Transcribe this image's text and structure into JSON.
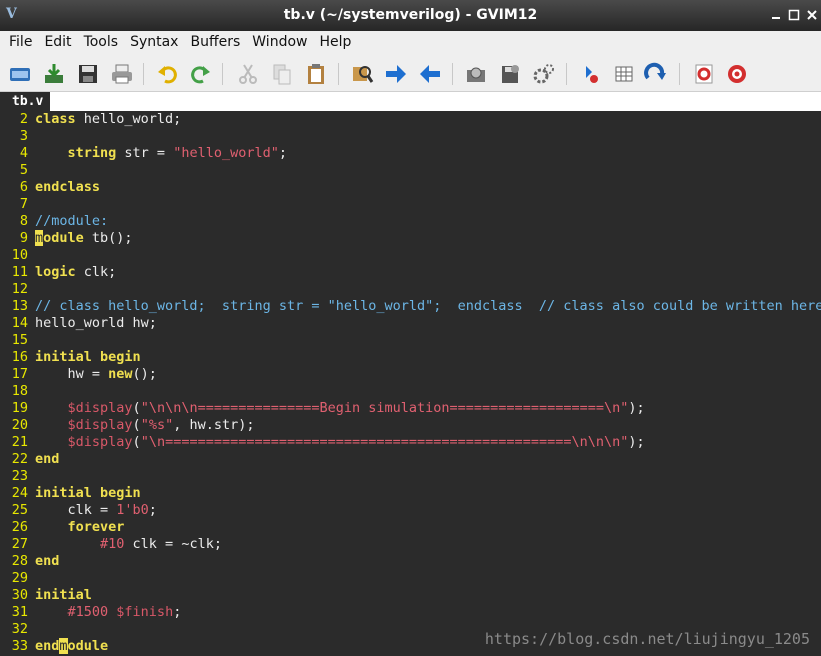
{
  "window": {
    "title": "tb.v (~/systemverilog) - GVIM12"
  },
  "menubar": {
    "items": [
      "File",
      "Edit",
      "Tools",
      "Syntax",
      "Buffers",
      "Window",
      "Help"
    ]
  },
  "toolbar": {
    "buttons": [
      "open-icon",
      "save-download-icon",
      "save-icon",
      "print-icon",
      "undo-icon",
      "redo-icon",
      "cut-icon",
      "copy-icon",
      "paste-icon",
      "find-replace-icon",
      "forward-arrow-icon",
      "back-arrow-icon",
      "load-session-icon",
      "save-session-icon",
      "run-script-icon",
      "make-icon",
      "table-icon",
      "jump-tag-icon",
      "help-icon",
      "find-help-icon"
    ]
  },
  "tab": {
    "label": "tb.v"
  },
  "editor": {
    "lines": [
      {
        "n": "2",
        "segments": [
          {
            "k": "kw",
            "t": "class"
          },
          {
            "k": "",
            "t": " hello_world;"
          }
        ]
      },
      {
        "n": "3",
        "segments": []
      },
      {
        "n": "4",
        "segments": [
          {
            "k": "",
            "t": "    "
          },
          {
            "k": "kw",
            "t": "string"
          },
          {
            "k": "",
            "t": " str = "
          },
          {
            "k": "str",
            "t": "\"hello_world\""
          },
          {
            "k": "",
            "t": ";"
          }
        ]
      },
      {
        "n": "5",
        "segments": []
      },
      {
        "n": "6",
        "segments": [
          {
            "k": "kw",
            "t": "endclass"
          }
        ]
      },
      {
        "n": "7",
        "segments": []
      },
      {
        "n": "8",
        "segments": [
          {
            "k": "cmt",
            "t": "//module:"
          }
        ]
      },
      {
        "n": "9",
        "segments": [
          {
            "k": "cursor",
            "t": "m"
          },
          {
            "k": "kw",
            "t": "odule"
          },
          {
            "k": "",
            "t": " tb();"
          }
        ]
      },
      {
        "n": "10",
        "segments": []
      },
      {
        "n": "11",
        "segments": [
          {
            "k": "kw",
            "t": "logic"
          },
          {
            "k": "",
            "t": " clk;"
          }
        ]
      },
      {
        "n": "12",
        "segments": []
      },
      {
        "n": "13",
        "segments": [
          {
            "k": "cmt",
            "t": "// class hello_world;  string str = \"hello_world\";  endclass  // class also could be written here."
          }
        ]
      },
      {
        "n": "14",
        "segments": [
          {
            "k": "",
            "t": "hello_world hw;"
          }
        ]
      },
      {
        "n": "15",
        "segments": []
      },
      {
        "n": "16",
        "segments": [
          {
            "k": "kw",
            "t": "initial begin"
          }
        ]
      },
      {
        "n": "17",
        "segments": [
          {
            "k": "",
            "t": "    hw = "
          },
          {
            "k": "kw",
            "t": "new"
          },
          {
            "k": "",
            "t": "();"
          }
        ]
      },
      {
        "n": "18",
        "segments": []
      },
      {
        "n": "19",
        "segments": [
          {
            "k": "",
            "t": "    "
          },
          {
            "k": "sys",
            "t": "$display"
          },
          {
            "k": "",
            "t": "("
          },
          {
            "k": "str",
            "t": "\"\\n\\n\\n===============Begin simulation===================\\n\""
          },
          {
            "k": "",
            "t": ");"
          }
        ]
      },
      {
        "n": "20",
        "segments": [
          {
            "k": "",
            "t": "    "
          },
          {
            "k": "sys",
            "t": "$display"
          },
          {
            "k": "",
            "t": "("
          },
          {
            "k": "str",
            "t": "\"%s\""
          },
          {
            "k": "",
            "t": ", hw.str);"
          }
        ]
      },
      {
        "n": "21",
        "segments": [
          {
            "k": "",
            "t": "    "
          },
          {
            "k": "sys",
            "t": "$display"
          },
          {
            "k": "",
            "t": "("
          },
          {
            "k": "str",
            "t": "\"\\n==================================================\\n\\n\\n\""
          },
          {
            "k": "",
            "t": ");"
          }
        ]
      },
      {
        "n": "22",
        "segments": [
          {
            "k": "kw",
            "t": "end"
          }
        ]
      },
      {
        "n": "23",
        "segments": []
      },
      {
        "n": "24",
        "segments": [
          {
            "k": "kw",
            "t": "initial begin"
          }
        ]
      },
      {
        "n": "25",
        "segments": [
          {
            "k": "",
            "t": "    clk = "
          },
          {
            "k": "str",
            "t": "1'b0"
          },
          {
            "k": "",
            "t": ";"
          }
        ]
      },
      {
        "n": "26",
        "segments": [
          {
            "k": "",
            "t": "    "
          },
          {
            "k": "kw",
            "t": "forever"
          }
        ]
      },
      {
        "n": "27",
        "segments": [
          {
            "k": "",
            "t": "        "
          },
          {
            "k": "str",
            "t": "#10"
          },
          {
            "k": "",
            "t": " clk = ~clk;"
          }
        ]
      },
      {
        "n": "28",
        "segments": [
          {
            "k": "kw",
            "t": "end"
          }
        ]
      },
      {
        "n": "29",
        "segments": []
      },
      {
        "n": "30",
        "segments": [
          {
            "k": "kw",
            "t": "initial"
          }
        ]
      },
      {
        "n": "31",
        "segments": [
          {
            "k": "",
            "t": "    "
          },
          {
            "k": "str",
            "t": "#1500"
          },
          {
            "k": "",
            "t": " "
          },
          {
            "k": "sys",
            "t": "$finish"
          },
          {
            "k": "",
            "t": ";"
          }
        ]
      },
      {
        "n": "32",
        "segments": []
      },
      {
        "n": "33",
        "segments": [
          {
            "k": "kw",
            "t": "end"
          },
          {
            "k": "cursor",
            "t": "m"
          },
          {
            "k": "kw",
            "t": "odule"
          }
        ]
      }
    ]
  },
  "watermark": "https://blog.csdn.net/liujingyu_1205"
}
